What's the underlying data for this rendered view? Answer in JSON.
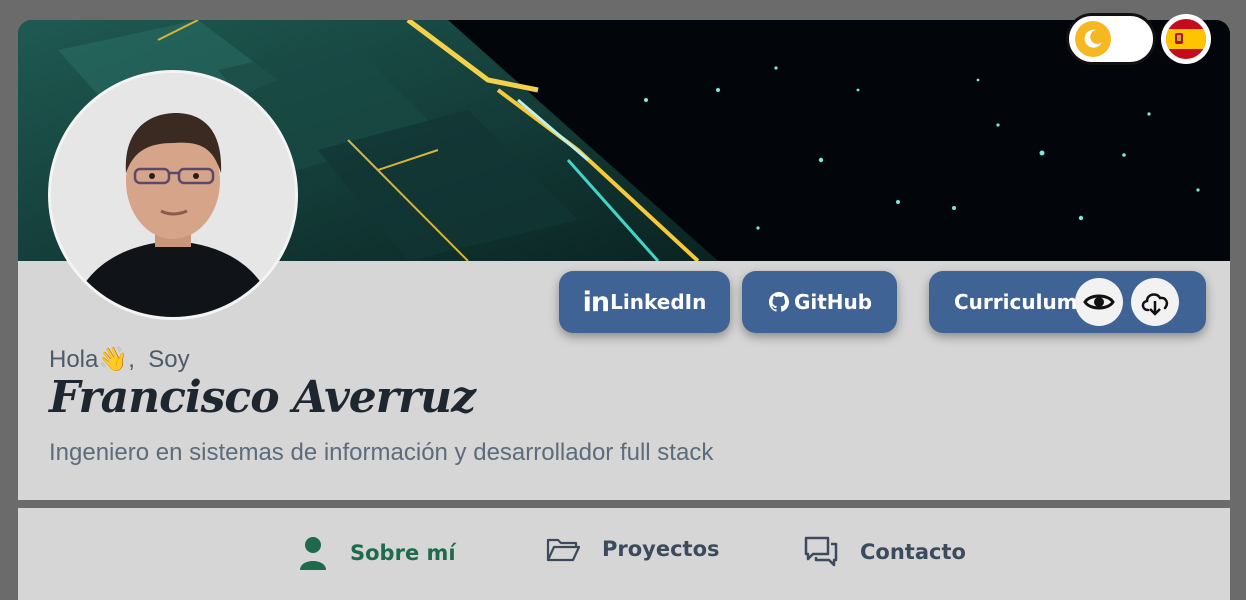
{
  "header": {
    "theme_toggle_icon": "moon-icon",
    "language_flag_icon": "spain-flag-icon"
  },
  "profile": {
    "greeting": "Hola",
    "greeting_emoji": "👋",
    "greeting_suffix": ",  Soy",
    "name": "Francisco Averruz",
    "subtitle": "Ingeniero en sistemas de información y desarrollador full stack"
  },
  "links": {
    "linkedin_mark": "in",
    "linkedin_label": "LinkedIn",
    "github_label": "GitHub",
    "cv_label": "Curriculum"
  },
  "nav": {
    "items": [
      {
        "label": "Sobre mí",
        "icon": "user-icon",
        "active": true
      },
      {
        "label": "Proyectos",
        "icon": "folder-icon",
        "active": false
      },
      {
        "label": "Contacto",
        "icon": "chat-icon",
        "active": false
      }
    ]
  },
  "colors": {
    "button_bg": "#3f6394",
    "active_nav": "#1e6a4a",
    "toggle_knob": "#f5b820"
  }
}
